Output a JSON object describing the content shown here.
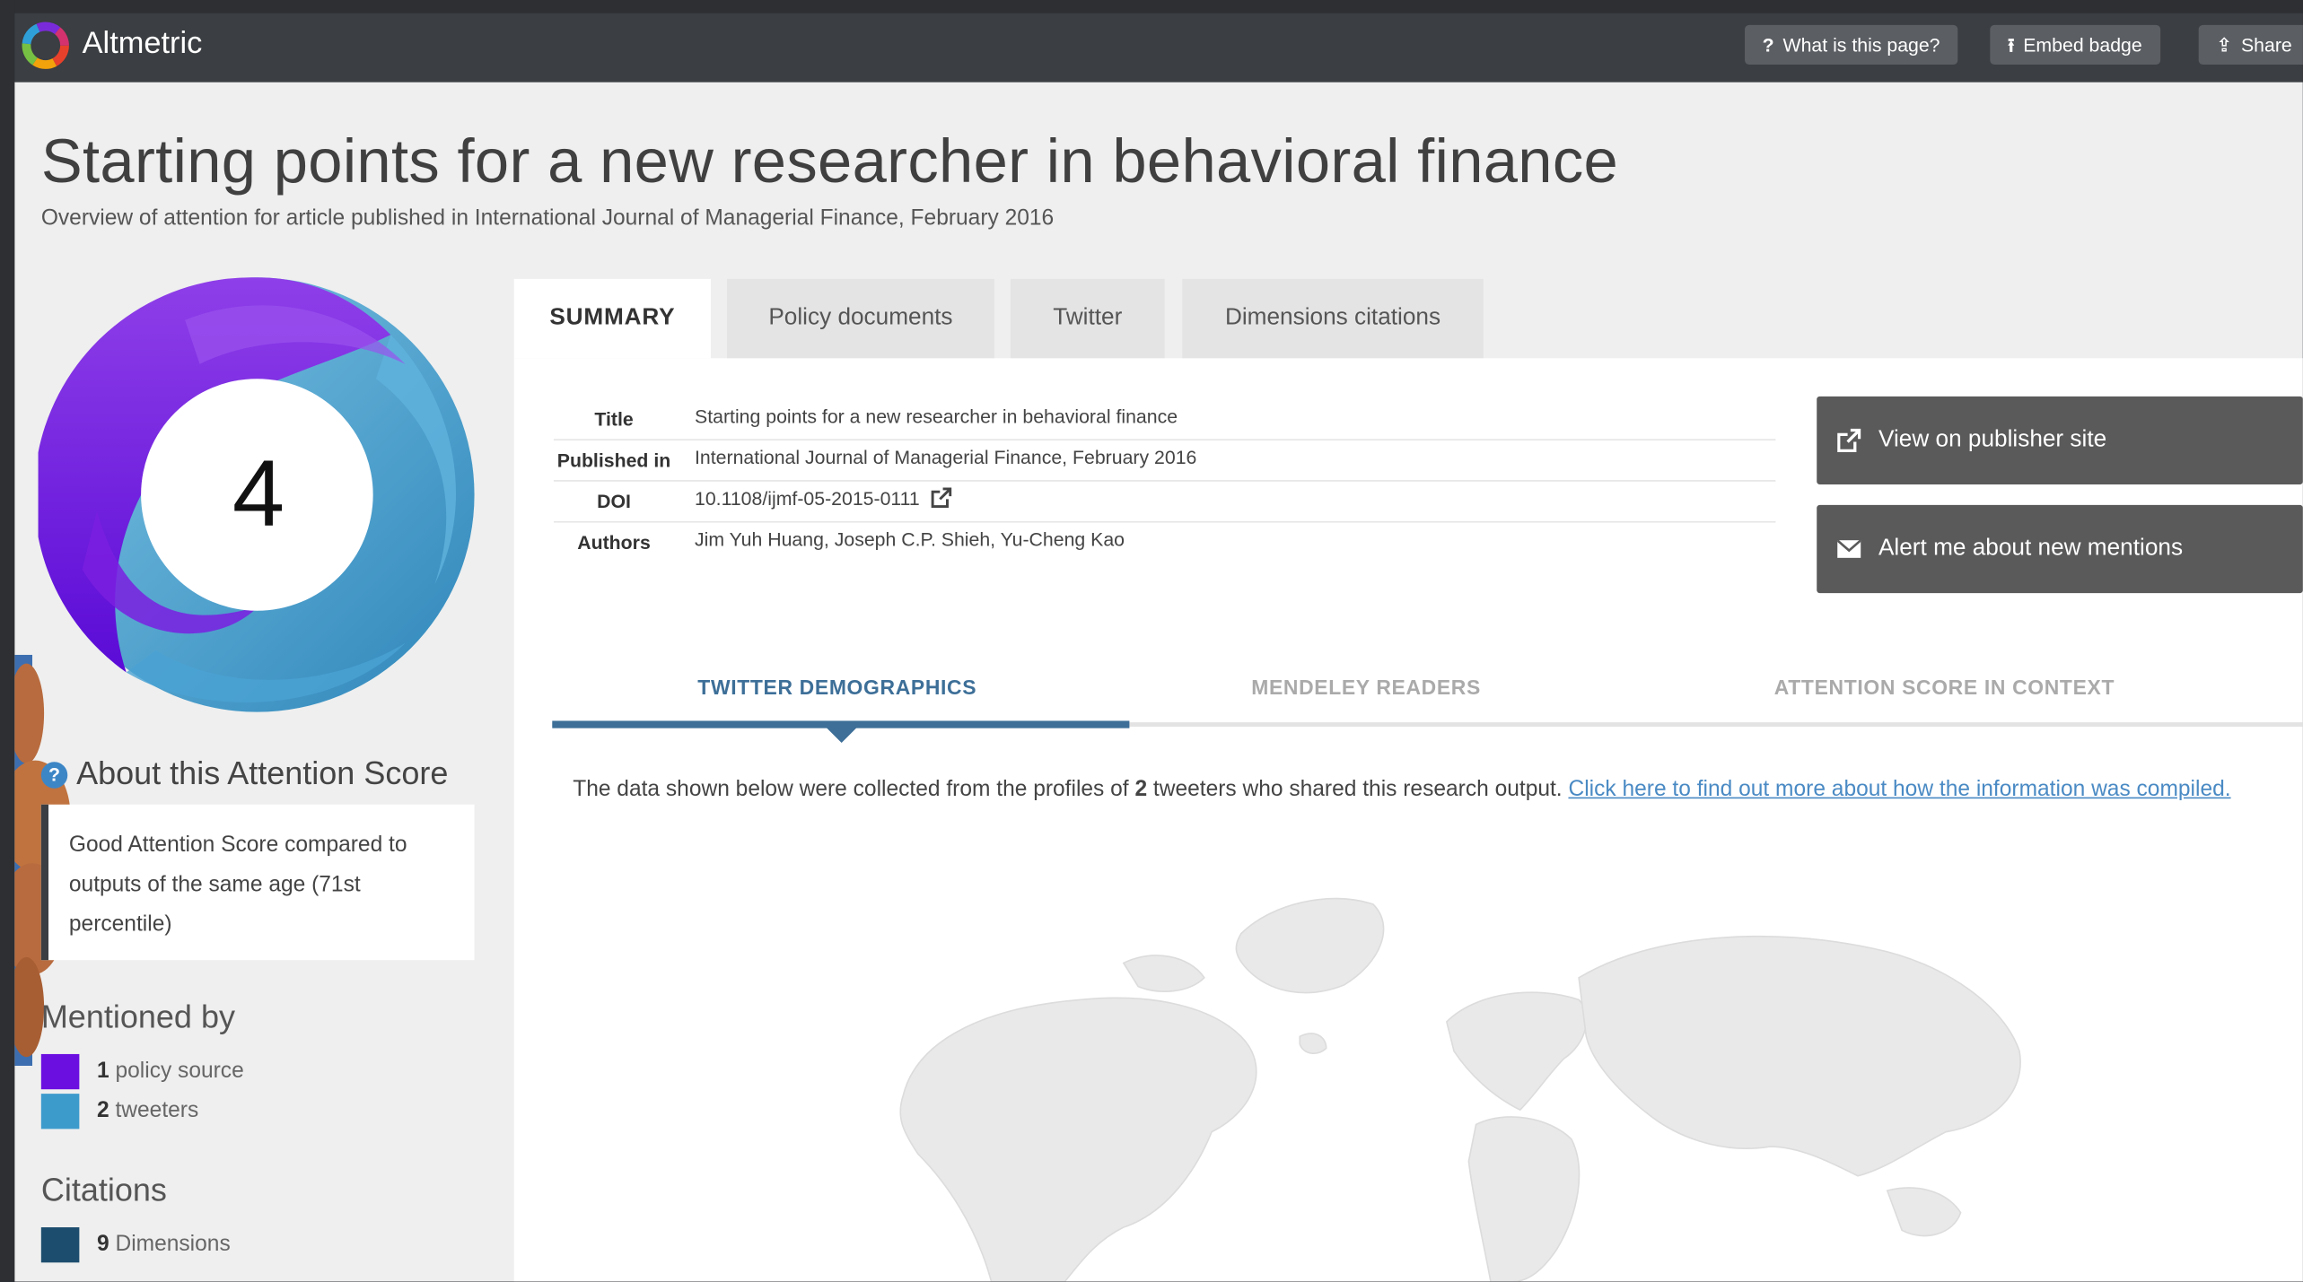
{
  "header": {
    "brand": "Altmetric",
    "buttons": [
      {
        "icon": "question-icon",
        "glyph": "?",
        "label": "What is this page?"
      },
      {
        "icon": "pin-icon",
        "glyph": "⭱",
        "label": "Embed badge"
      },
      {
        "icon": "share-icon",
        "glyph": "⇪",
        "label": "Share"
      }
    ]
  },
  "page": {
    "title": "Starting points for a new researcher in behavioral finance",
    "subtitle": "Overview of attention for article published in International Journal of Managerial Finance, February 2016"
  },
  "score": {
    "value": "4",
    "about_title": "About this Attention Score",
    "about_text": "Good Attention Score compared to outputs of the same age (71st percentile)"
  },
  "mentioned_by": {
    "title": "Mentioned by",
    "items": [
      {
        "count": "1",
        "label": "policy source",
        "color": "#6b0fe0"
      },
      {
        "count": "2",
        "label": "tweeters",
        "color": "#3d9bcc"
      }
    ]
  },
  "citations": {
    "title": "Citations",
    "items": [
      {
        "count": "9",
        "label": "Dimensions",
        "color": "#1d4d6e"
      }
    ]
  },
  "tabs": [
    {
      "label": "SUMMARY",
      "active": true
    },
    {
      "label": "Policy documents",
      "active": false
    },
    {
      "label": "Twitter",
      "active": false
    },
    {
      "label": "Dimensions citations",
      "active": false
    }
  ],
  "metadata": {
    "title_label": "Title",
    "title_value": "Starting points for a new researcher in behavioral finance",
    "published_label": "Published in",
    "published_value": "International Journal of Managerial Finance, February 2016",
    "doi_label": "DOI",
    "doi_value": "10.1108/ijmf-05-2015-0111",
    "authors_label": "Authors",
    "authors_value": "Jim Yuh Huang, Joseph C.P. Shieh, Yu-Cheng Kao"
  },
  "actions": {
    "publisher": "View on publisher site",
    "alert": "Alert me about new mentions"
  },
  "subtabs": [
    {
      "label": "TWITTER DEMOGRAPHICS",
      "active": true
    },
    {
      "label": "MENDELEY READERS",
      "active": false
    },
    {
      "label": "ATTENTION SCORE IN CONTEXT",
      "active": false
    }
  ],
  "demographics": {
    "text_before": "The data shown below were collected from the profiles of ",
    "count": "2",
    "text_after": " tweeters who shared this research output. ",
    "link": "Click here to find out more about how the information was compiled."
  },
  "colors": {
    "header_bg": "#3b3e42",
    "accent_blue": "#3d6f98",
    "policy_purple": "#6b0fe0",
    "twitter_blue": "#3d9bcc",
    "dimensions_navy": "#1d4d6e"
  }
}
